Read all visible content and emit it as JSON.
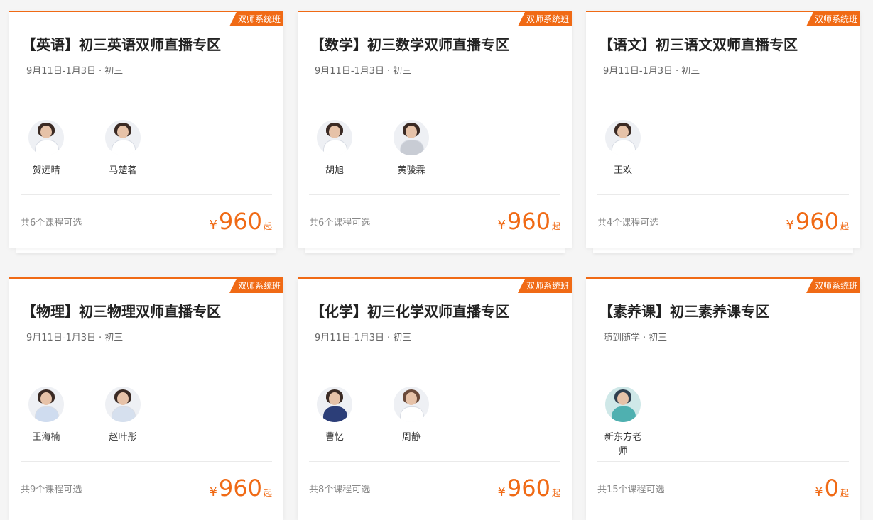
{
  "colors": {
    "accent": "#f06a15",
    "title": "#222222",
    "muted": "#888888"
  },
  "cards": [
    {
      "badge": "双师系统班",
      "title": "【英语】初三英语双师直播专区",
      "date": "9月11日-1月3日",
      "dot": "·",
      "grade": "初三",
      "teachers": [
        {
          "name": "贺远晴"
        },
        {
          "name": "马楚茗"
        }
      ],
      "count": "共6个课程可选",
      "currency": "¥",
      "price": "960",
      "suffix": "起"
    },
    {
      "badge": "双师系统班",
      "title": "【数学】初三数学双师直播专区",
      "date": "9月11日-1月3日",
      "dot": "·",
      "grade": "初三",
      "teachers": [
        {
          "name": "胡旭"
        },
        {
          "name": "黄骏霖"
        }
      ],
      "count": "共6个课程可选",
      "currency": "¥",
      "price": "960",
      "suffix": "起"
    },
    {
      "badge": "双师系统班",
      "title": "【语文】初三语文双师直播专区",
      "date": "9月11日-1月3日",
      "dot": "·",
      "grade": "初三",
      "teachers": [
        {
          "name": "王欢"
        }
      ],
      "count": "共4个课程可选",
      "currency": "¥",
      "price": "960",
      "suffix": "起"
    },
    {
      "badge": "双师系统班",
      "title": "【物理】初三物理双师直播专区",
      "date": "9月11日-1月3日",
      "dot": "·",
      "grade": "初三",
      "teachers": [
        {
          "name": "王海楠"
        },
        {
          "name": "赵叶彤"
        }
      ],
      "count": "共9个课程可选",
      "currency": "¥",
      "price": "960",
      "suffix": "起"
    },
    {
      "badge": "双师系统班",
      "title": "【化学】初三化学双师直播专区",
      "date": "9月11日-1月3日",
      "dot": "·",
      "grade": "初三",
      "teachers": [
        {
          "name": "曹忆"
        },
        {
          "name": "周静"
        }
      ],
      "count": "共8个课程可选",
      "currency": "¥",
      "price": "960",
      "suffix": "起"
    },
    {
      "badge": "双师系统班",
      "title": "【素养课】初三素养课专区",
      "date": "随到随学",
      "dot": "·",
      "grade": "初三",
      "teachers": [
        {
          "name": "新东方老师"
        }
      ],
      "count": "共15个课程可选",
      "currency": "¥",
      "price": "0",
      "suffix": "起"
    }
  ]
}
